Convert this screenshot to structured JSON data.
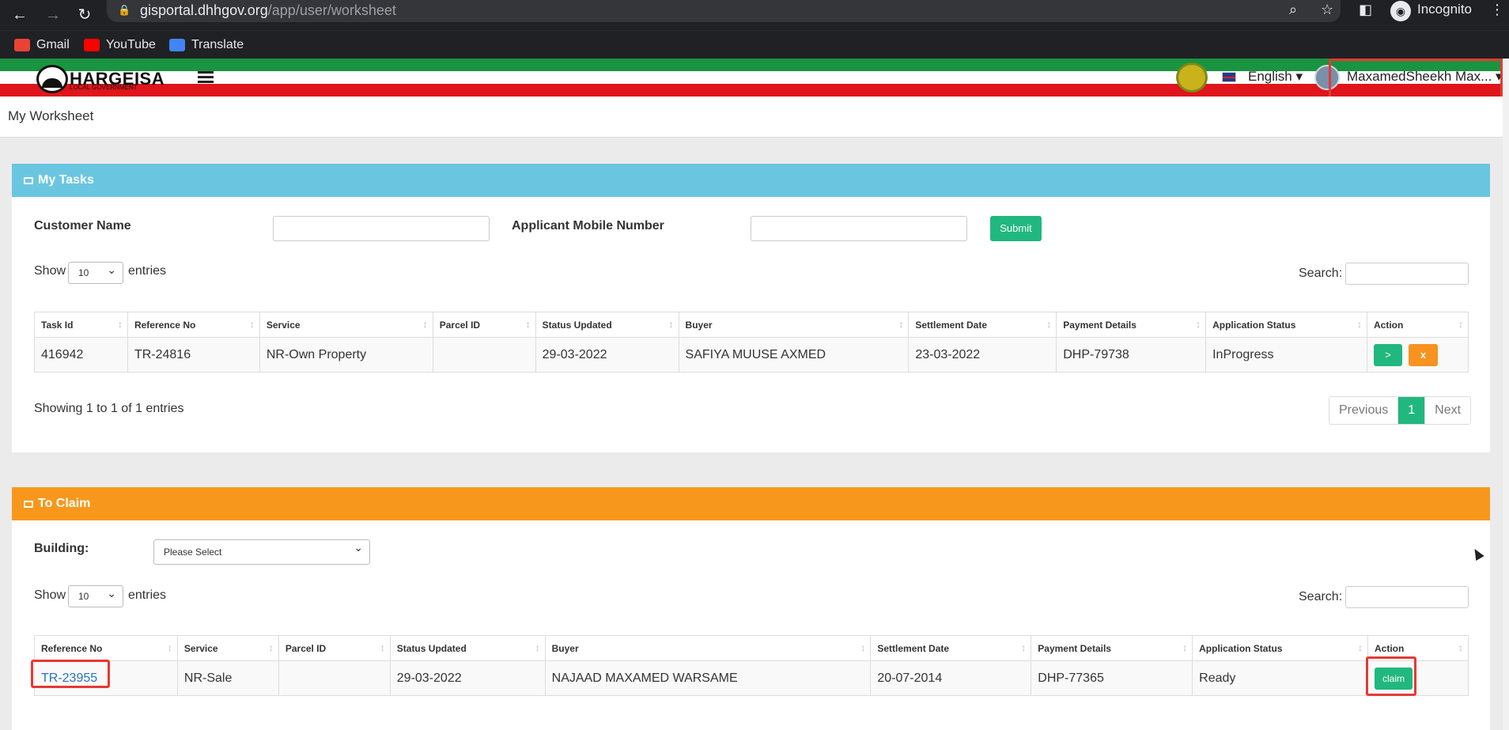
{
  "browser": {
    "url_host": "gisportal.dhhgov.org",
    "url_path": "/app/user/worksheet",
    "incognito_label": "Incognito",
    "bookmarks": [
      {
        "label": "Gmail",
        "color": "#ea4335"
      },
      {
        "label": "YouTube",
        "color": "#ff0000"
      },
      {
        "label": "Translate",
        "color": "#4285f4"
      }
    ]
  },
  "header": {
    "logo_text": "HARGEISA",
    "logo_sub": "LOCAL GOVERNMENT",
    "language": "English",
    "user_name": "MaxamedSheekh Max..."
  },
  "page": {
    "title": "My Worksheet"
  },
  "my_tasks": {
    "title": "My Tasks",
    "color": "#6ac6e0",
    "customer_name_label": "Customer Name",
    "mobile_label": "Applicant Mobile Number",
    "submit_label": "Submit",
    "show_label": "Show",
    "entries_value": "10",
    "entries_label": "entries",
    "search_label": "Search:",
    "columns": [
      "Task Id",
      "Reference No",
      "Service",
      "Parcel ID",
      "Status Updated",
      "Buyer",
      "Settlement Date",
      "Payment Details",
      "Application Status",
      "Action"
    ],
    "rows": [
      {
        "task_id": "416942",
        "reference_no": "TR-24816",
        "service": "NR-Own Property",
        "parcel_id": "",
        "status_updated": "29-03-2022",
        "buyer": "SAFIYA MUUSE AXMED",
        "settlement_date": "23-03-2022",
        "payment_details": "DHP-79738",
        "application_status": "InProgress",
        "action_go": ">",
        "action_cancel": "x"
      }
    ],
    "showing": "Showing 1 to 1 of 1 entries",
    "pager": {
      "previous": "Previous",
      "current": "1",
      "next": "Next"
    }
  },
  "to_claim": {
    "title": "To Claim",
    "color": "#f7981d",
    "building_label": "Building:",
    "building_select": "Please Select",
    "show_label": "Show",
    "entries_value": "10",
    "entries_label": "entries",
    "search_label": "Search:",
    "columns": [
      "Reference No",
      "Service",
      "Parcel ID",
      "Status Updated",
      "Buyer",
      "Settlement Date",
      "Payment Details",
      "Application Status",
      "Action"
    ],
    "rows": [
      {
        "reference_no": "TR-23955",
        "service": "NR-Sale",
        "parcel_id": "",
        "status_updated": "29-03-2022",
        "buyer": "NAJAAD MAXAMED WARSAME",
        "settlement_date": "20-07-2014",
        "payment_details": "DHP-77365",
        "application_status": "Ready",
        "action_claim": "claim"
      }
    ]
  }
}
